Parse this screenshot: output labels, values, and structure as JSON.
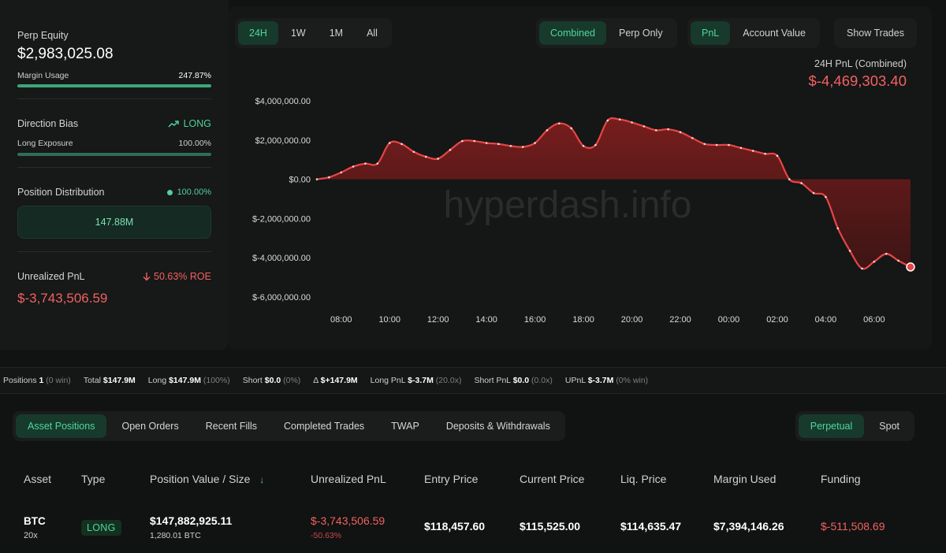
{
  "left": {
    "perp_equity_label": "Perp Equity",
    "perp_equity_value": "$2,983,025.08",
    "margin_usage_label": "Margin Usage",
    "margin_usage_value": "247.87%",
    "margin_usage_fill": 1.0,
    "direction_label": "Direction Bias",
    "direction_value": "LONG",
    "long_exposure_label": "Long Exposure",
    "long_exposure_value": "100.00%",
    "long_exposure_fill": 1.0,
    "distribution_label": "Position Distribution",
    "distribution_value": "100.00%",
    "distribution_box": "147.88M",
    "upnl_label": "Unrealized PnL",
    "upnl_roe": "50.63% ROE",
    "upnl_value": "$-3,743,506.59"
  },
  "range_tabs": [
    "24H",
    "1W",
    "1M",
    "All"
  ],
  "range_active": 0,
  "mode_tabs": [
    "Combined",
    "Perp Only"
  ],
  "mode_active": 0,
  "metric_tabs": [
    "PnL",
    "Account Value"
  ],
  "metric_active": 0,
  "show_trades_label": "Show Trades",
  "pnl_caption": "24H PnL (Combined)",
  "pnl_value": "$-4,469,303.40",
  "watermark": "hyperdash.info",
  "chart_data": {
    "type": "area",
    "x": [
      "07:00",
      "07:30",
      "08:00",
      "08:30",
      "09:00",
      "09:30",
      "10:00",
      "10:30",
      "11:00",
      "11:30",
      "12:00",
      "12:30",
      "13:00",
      "13:30",
      "14:00",
      "14:30",
      "15:00",
      "15:30",
      "16:00",
      "16:30",
      "17:00",
      "17:30",
      "18:00",
      "18:30",
      "19:00",
      "19:30",
      "20:00",
      "20:30",
      "21:00",
      "21:30",
      "22:00",
      "22:30",
      "23:00",
      "23:30",
      "00:00",
      "00:30",
      "01:00",
      "01:30",
      "02:00",
      "02:30",
      "03:00",
      "03:30",
      "04:00",
      "04:30",
      "05:00",
      "05:30",
      "06:00",
      "06:30",
      "07:00",
      "07:30"
    ],
    "series": [
      {
        "values": [
          0,
          100000,
          350000,
          650000,
          800000,
          800000,
          1850000,
          1800000,
          1400000,
          1150000,
          1050000,
          1500000,
          1950000,
          1950000,
          1850000,
          1800000,
          1700000,
          1650000,
          1850000,
          2500000,
          2850000,
          2600000,
          1700000,
          1750000,
          3000000,
          3050000,
          2900000,
          2700000,
          2500000,
          2550000,
          2400000,
          2100000,
          1800000,
          1750000,
          1750000,
          1600000,
          1450000,
          1300000,
          1200000,
          0,
          -200000,
          -700000,
          -900000,
          -2500000,
          -3650000,
          -4550000,
          -4200000,
          -3800000,
          -4150000,
          -4470000
        ]
      }
    ],
    "yticks": [
      "$4,000,000.00",
      "$2,000,000.00",
      "$0.00",
      "$-2,000,000.00",
      "$-4,000,000.00",
      "$-6,000,000.00"
    ],
    "xticks": [
      "08:00",
      "10:00",
      "12:00",
      "14:00",
      "16:00",
      "18:00",
      "20:00",
      "22:00",
      "00:00",
      "02:00",
      "04:00",
      "06:00"
    ],
    "ylim": [
      -6000000,
      4000000
    ],
    "grid": false,
    "colors": {
      "line": "#e84545",
      "fill": "#6e1a1a"
    }
  },
  "stats": [
    {
      "k": "Positions",
      "v": "1",
      "p": "(0 win)"
    },
    {
      "k": "Total",
      "v": "$147.9M",
      "p": ""
    },
    {
      "k": "Long",
      "v": "$147.9M",
      "p": "(100%)"
    },
    {
      "k": "Short",
      "v": "$0.0",
      "p": "(0%)"
    },
    {
      "k": "Δ",
      "v": "$+147.9M",
      "p": "",
      "vc": "green"
    },
    {
      "k": "Long PnL",
      "v": "$-3.7M",
      "p": "(20.0x)",
      "vc": "red"
    },
    {
      "k": "Short PnL",
      "v": "$0.0",
      "p": "(0.0x)",
      "vc": "green"
    },
    {
      "k": "UPnL",
      "v": "$-3.7M",
      "p": "(0% win)",
      "vc": "red"
    }
  ],
  "tabs": [
    "Asset Positions",
    "Open Orders",
    "Recent Fills",
    "Completed Trades",
    "TWAP",
    "Deposits & Withdrawals"
  ],
  "tab_active": 0,
  "market_tabs": [
    "Perpetual",
    "Spot"
  ],
  "market_active": 0,
  "table": {
    "headers": [
      "Asset",
      "Type",
      "Position Value / Size",
      "Unrealized PnL",
      "Entry Price",
      "Current Price",
      "Liq. Price",
      "Margin Used",
      "Funding"
    ],
    "sort_arrow": "↓",
    "row": {
      "asset": "BTC",
      "leverage": "20x",
      "type": "LONG",
      "value": "$147,882,925.11",
      "size": "1,280.01 BTC",
      "upnl": "$-3,743,506.59",
      "upnl_pct": "-50.63%",
      "entry": "$118,457.60",
      "current": "$115,525.00",
      "liq": "$114,635.47",
      "margin": "$7,394,146.26",
      "funding": "$-511,508.69"
    }
  },
  "icons": {
    "trend": "trending-up-icon",
    "down": "arrow-down-icon",
    "dot": "status-dot-icon"
  }
}
